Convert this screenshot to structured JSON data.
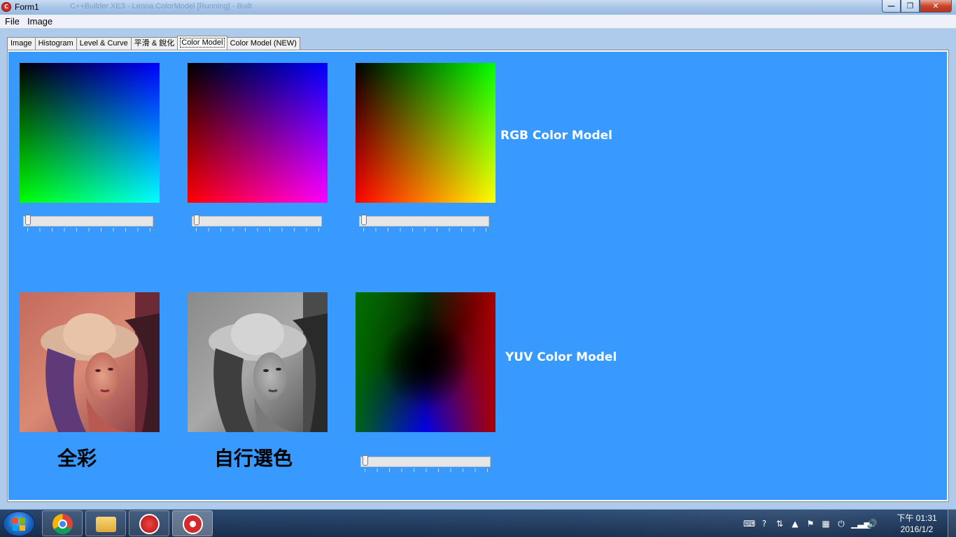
{
  "window": {
    "title": "Form1",
    "background_title_text": "C++Builder XE3 - Lenna ColorModel [Running] - Built",
    "controls": {
      "minimize": "—",
      "maximize": "❐",
      "close": "✕"
    }
  },
  "menu": {
    "items": [
      "File",
      "Image"
    ]
  },
  "tabs": [
    {
      "label": "Image",
      "active": false
    },
    {
      "label": "Histogram",
      "active": false
    },
    {
      "label": "Level & Curve",
      "active": false
    },
    {
      "label": "平滑 & 銳化",
      "active": false
    },
    {
      "label": "Color Model",
      "active": true
    },
    {
      "label": "Color Model (NEW)",
      "active": false
    }
  ],
  "panel": {
    "rgb_label": "RGB Color Model",
    "yuv_label": "YUV Color Model",
    "full_color_label": "全彩",
    "custom_color_label": "自行選色",
    "accent_color": "#3899ff",
    "swatches": [
      {
        "name": "R=0 plane",
        "axes": "G vertical, B horizontal"
      },
      {
        "name": "G=0 plane",
        "axes": "R vertical, B horizontal"
      },
      {
        "name": "B=0 plane",
        "axes": "R vertical, G horizontal"
      },
      {
        "name": "YUV plane"
      }
    ],
    "sliders": [
      {
        "name": "red-slider",
        "value": 0
      },
      {
        "name": "green-slider",
        "value": 0
      },
      {
        "name": "blue-slider",
        "value": 0
      },
      {
        "name": "y-slider",
        "value": 0
      }
    ]
  },
  "taskbar": {
    "apps": [
      {
        "name": "chrome-icon",
        "active": false
      },
      {
        "name": "file-explorer-icon",
        "active": false
      },
      {
        "name": "bank-app-icon",
        "active": false
      },
      {
        "name": "cpp-builder-icon",
        "active": true
      }
    ],
    "tray_icons": [
      "keyboard-icon",
      "help-icon",
      "network-arrows-icon",
      "show-hidden-icon",
      "action-center-flag-icon",
      "windows-icon",
      "power-plug-icon",
      "signal-bars-icon",
      "volume-icon"
    ],
    "clock_time": "下午 01:31",
    "clock_date": "2016/1/2"
  }
}
